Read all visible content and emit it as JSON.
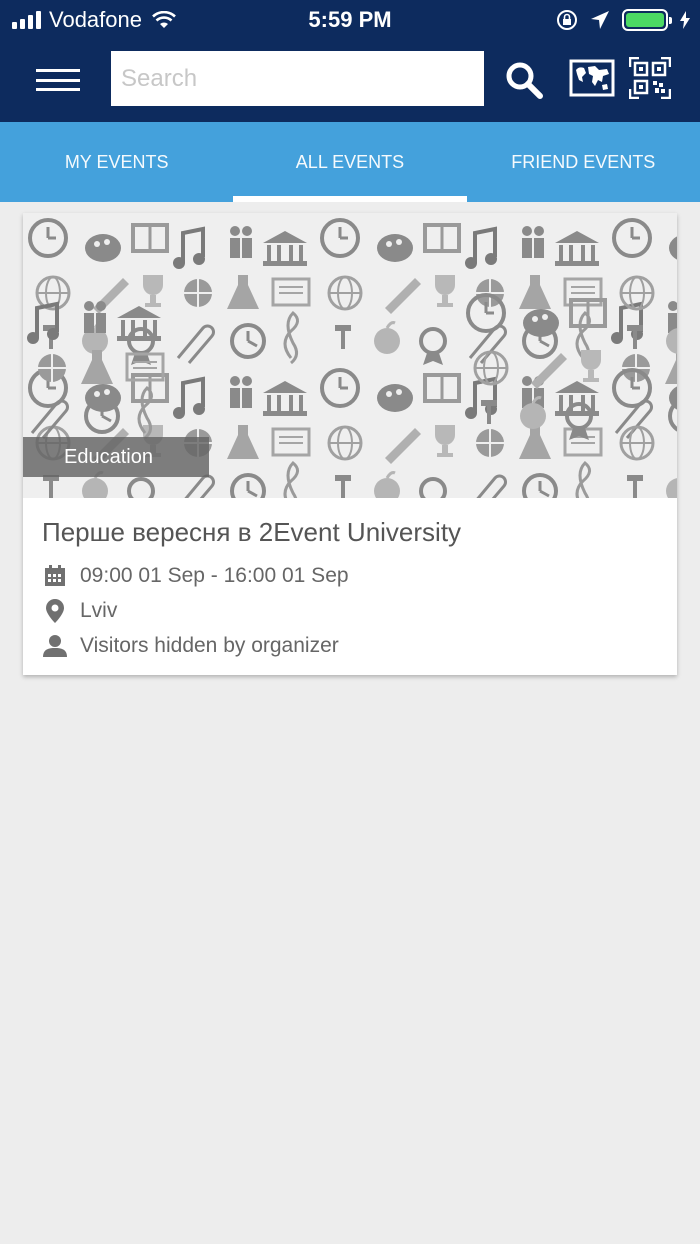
{
  "status_bar": {
    "carrier": "Vodafone",
    "time": "5:59 PM",
    "battery_percent": 100
  },
  "app_bar": {
    "menu_icon": "hamburger-icon",
    "search_placeholder": "Search",
    "search_value": "",
    "search_icon": "search-icon",
    "map_icon": "world-map-icon",
    "qr_icon": "qr-code-icon"
  },
  "tabs": [
    {
      "label": "MY EVENTS",
      "active": false
    },
    {
      "label": "ALL EVENTS",
      "active": true
    },
    {
      "label": "FRIEND EVENTS",
      "active": false
    }
  ],
  "event": {
    "category": "Education",
    "title": "Перше вересня в 2Event University",
    "datetime": "09:00 01 Sep - 16:00 01 Sep",
    "location": "Lviv",
    "visitors": "Visitors hidden by organizer"
  },
  "colors": {
    "header_bg": "#0d2b5e",
    "tabs_bg": "#44a1dc",
    "page_bg": "#ededed",
    "battery": "#4cd964"
  }
}
